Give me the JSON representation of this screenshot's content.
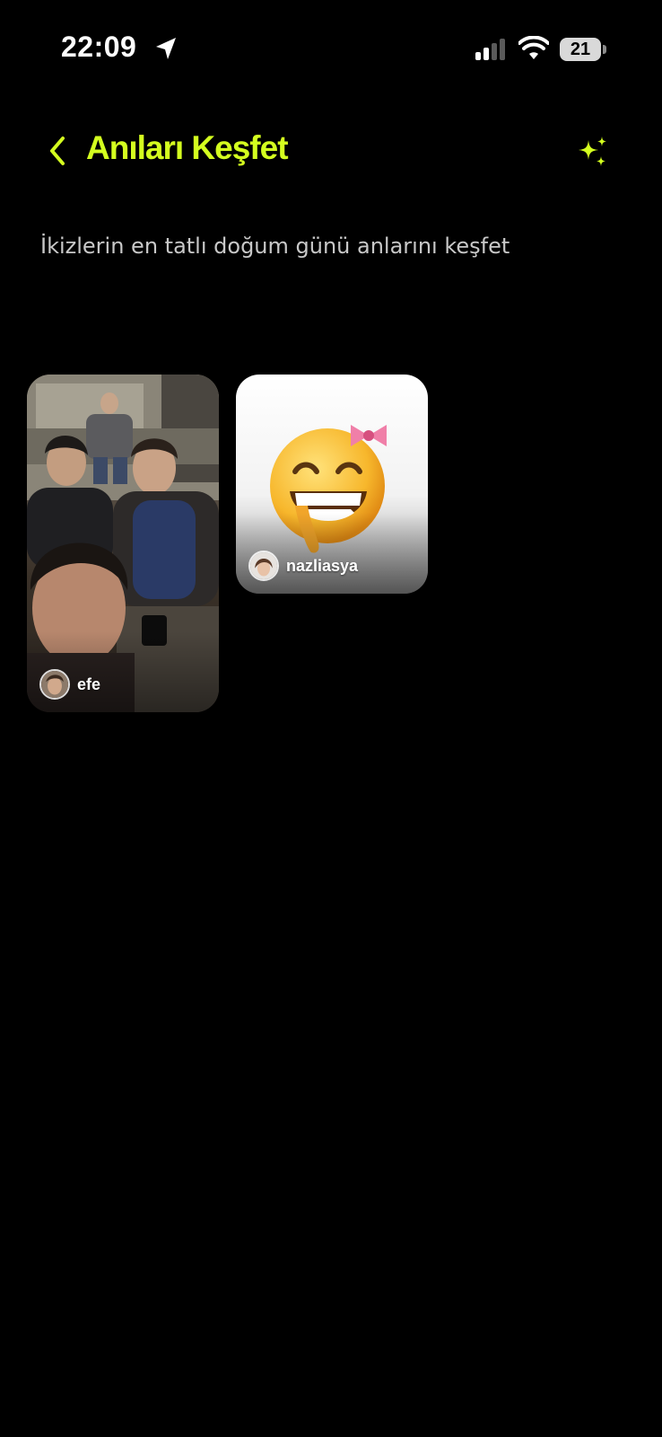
{
  "status_bar": {
    "time": "22:09",
    "battery_level": "21",
    "location_icon": "location-arrow-icon",
    "signal_icon": "cellular-signal-icon",
    "wifi_icon": "wifi-icon"
  },
  "header": {
    "back_icon": "chevron-left-icon",
    "title": "Anıları Keşfet",
    "action_icon": "sparkles-icon"
  },
  "subtitle": "İkizlerin en tatlı doğum günü anlarını keşfet",
  "theme": {
    "accent": "#d4ff1f",
    "background": "#000000",
    "subtitle_color": "#c8c8c8"
  },
  "memories": [
    {
      "username": "efe",
      "media": "group-selfie-photo"
    },
    {
      "username": "nazliasya",
      "media": "smiling-emoji-with-bow"
    }
  ]
}
